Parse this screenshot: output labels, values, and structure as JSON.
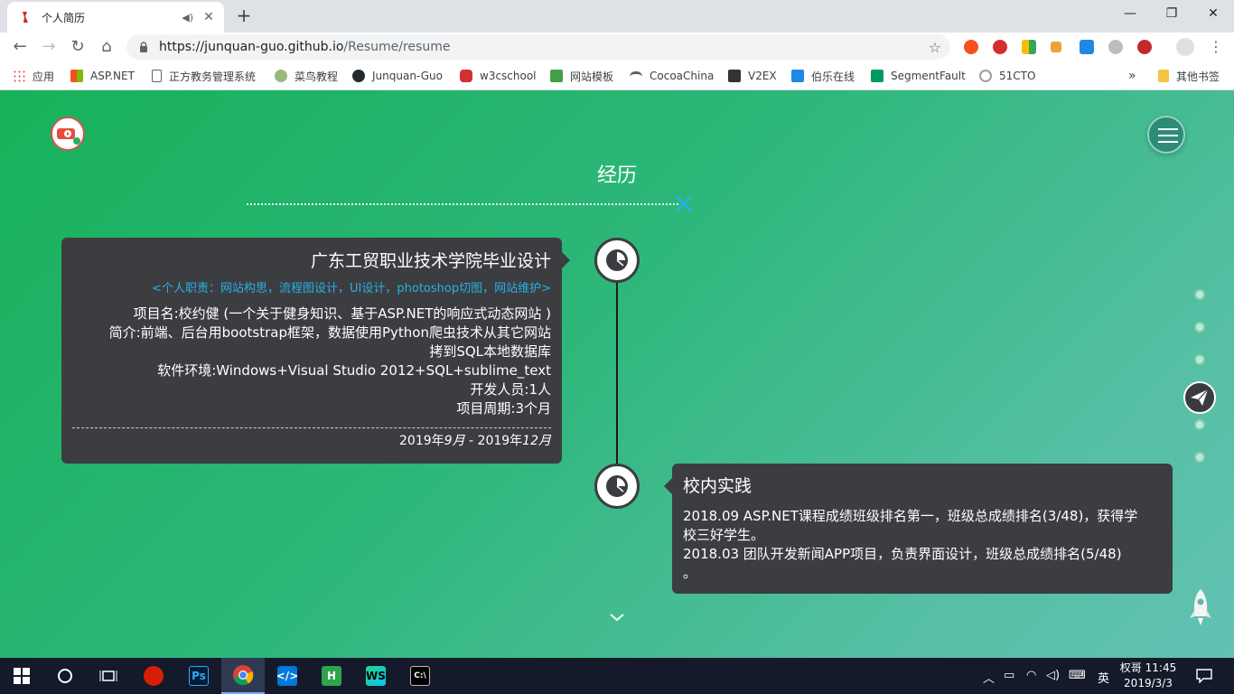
{
  "browser": {
    "tab_title": "个人简历",
    "url_host": "https://junquan-guo.github.io",
    "url_path": "/Resume/resume",
    "bookmarks": [
      "应用",
      "ASP.NET",
      "正方教务管理系统",
      "菜鸟教程",
      "Junquan-Guo",
      "w3cschool",
      "网站模板",
      "CocoaChina",
      "V2EX",
      "伯乐在线",
      "SegmentFault",
      "51CTO"
    ],
    "overflow": "»",
    "other_bookmarks": "其他书签"
  },
  "page": {
    "section_title": "经历",
    "card1": {
      "title": "广东工贸职业技术学院毕业设计",
      "role": "<个人职责：网站构思，流程图设计，UI设计，photoshop切图，网站维护>",
      "lines": [
        "项目名:校约健 (一个关于健身知识、基于ASP.NET的响应式动态网站 )",
        "简介:前端、后台用bootstrap框架，数据使用Python爬虫技术从其它网站",
        "拷到SQL本地数据库",
        "软件环境:Windows+Visual Studio 2012+SQL+sublime_text",
        "开发人员:1人",
        "项目周期:3个月"
      ],
      "period_a": "2019年",
      "period_b": "9月",
      "period_c": " - 2019年",
      "period_d": "12月"
    },
    "card2": {
      "title": "校内实践",
      "lines": [
        "2018.09 ASP.NET课程成绩班级排名第一，班级总成绩排名(3/48)，获得学",
        "校三好学生。",
        "2018.03 团队开发新闻APP项目，负责界面设计，班级总成绩排名(5/48)",
        "。"
      ]
    }
  },
  "taskbar": {
    "tray_lang": "英",
    "tray_user": "权哥",
    "time": "11:45",
    "date": "2019/3/3"
  },
  "colors": {
    "page_gradient_start": "#17b15a",
    "page_gradient_end": "#62c2b3",
    "card_bg": "#3c3d40",
    "role_text": "#29b0e6"
  },
  "icons": [
    "back-icon",
    "forward-icon",
    "reload-icon",
    "home-icon",
    "lock-icon",
    "star-icon",
    "hamburger-icon",
    "pie-chart-icon",
    "paper-plane-icon",
    "chevron-down-icon",
    "rocket-icon"
  ]
}
